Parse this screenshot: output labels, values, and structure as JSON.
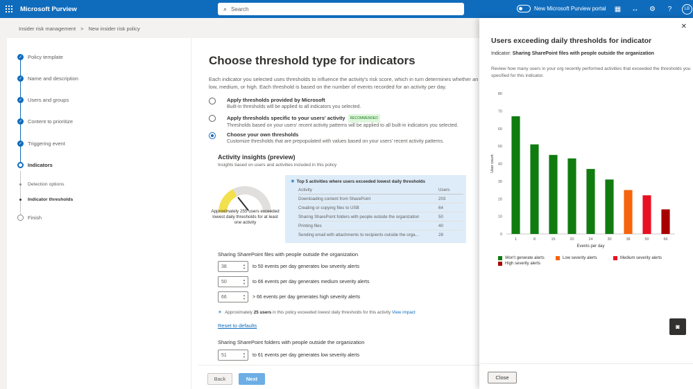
{
  "topbar": {
    "app_title": "Microsoft Purview",
    "search_placeholder": "Search",
    "portal_toggle_label": "New Microsoft Purview portal",
    "avatar_initials": "LB",
    "icons": [
      "waffle-icon",
      "search-icon",
      "chart-icon",
      "share-icon",
      "gear-icon",
      "help-icon"
    ]
  },
  "breadcrumb": {
    "items": [
      "Insider risk management",
      "New insider risk policy"
    ],
    "separator": ">"
  },
  "steps": [
    {
      "label": "Policy template",
      "state": "done"
    },
    {
      "label": "Name and description",
      "state": "done"
    },
    {
      "label": "Users and groups",
      "state": "done"
    },
    {
      "label": "Content to prioritize",
      "state": "done"
    },
    {
      "label": "Triggering event",
      "state": "done"
    },
    {
      "label": "Indicators",
      "state": "current"
    },
    {
      "label": "Detection options",
      "state": "sub"
    },
    {
      "label": "Indicator thresholds",
      "state": "sub-current"
    },
    {
      "label": "Finish",
      "state": "todo"
    }
  ],
  "main": {
    "title": "Choose threshold type for indicators",
    "description": "Each indicator you selected uses thresholds to influence the activity's risk score, which in turn determines whether an alert is low, medium, or high. Each threshold is based on the number of events recorded for an activity per day.",
    "options": [
      {
        "title": "Apply thresholds provided by Microsoft",
        "desc": "Built-in thresholds will be applied to all indicators you selected.",
        "selected": false,
        "badge": ""
      },
      {
        "title": "Apply thresholds specific to your users' activity",
        "desc": "Thresholds based on your users' recent activity patterns will be applied to all built-in indicators you selected.",
        "selected": false,
        "badge": "RECOMMENDED"
      },
      {
        "title": "Choose your own thresholds",
        "desc": "Customize thresholds that are prepopulated with values based on your users' recent activity patterns.",
        "selected": true,
        "badge": ""
      }
    ],
    "insights_title": "Activity insights (preview)",
    "insights_subtitle": "Insights based on users and activities included in this policy",
    "gauge_text": "Approximately 255 users exceeded lowest daily thresholds for at least one activity",
    "gauge_fraction": 0.35,
    "top_activities": {
      "title": "Top 5 activities where users exceeded lowest daily thresholds",
      "col_activity": "Activity",
      "col_users": "Users",
      "rows": [
        {
          "activity": "Downloading content from SharePoint",
          "users": "203"
        },
        {
          "activity": "Creating or copying files to USB",
          "users": "64"
        },
        {
          "activity": "Sharing SharePoint folders with people outside the organization",
          "users": "50"
        },
        {
          "activity": "Printing files",
          "users": "40"
        },
        {
          "activity": "Sending email with attachments to recipients outside the orga...",
          "users": "28"
        }
      ]
    },
    "section1": {
      "title": "Sharing SharePoint files with people outside the organization",
      "thresholds": [
        {
          "value": "38",
          "text": "to 50 events per day generates low severity alerts"
        },
        {
          "value": "50",
          "text": "to 66 events per day generates medium severity alerts"
        },
        {
          "value": "66",
          "text": "> 66 events per day generates high severity alerts"
        }
      ],
      "approx_prefix": "Approximately",
      "approx_users": "25 users",
      "approx_suffix": "in this policy exceeded lowest daily thresholds for this activity",
      "approx_link": "View impact"
    },
    "reset_label": "Reset to defaults",
    "section2": {
      "title": "Sharing SharePoint folders with people outside the organization",
      "thresholds": [
        {
          "value": "51",
          "text": "to 61 events per day generates low severity alerts"
        }
      ]
    },
    "back_label": "Back",
    "next_label": "Next"
  },
  "panel": {
    "title": "Users exceeding daily thresholds for indicator",
    "indicator_label": "Indicator:",
    "indicator_value": "Sharing SharePoint files with people outside the organization",
    "description": "Review how many users in your org recently performed activities that exceeded the thresholds you specified for this indicator.",
    "close_label": "Close"
  },
  "chart_data": {
    "type": "bar",
    "categories": [
      "1",
      "8",
      "15",
      "20",
      "24",
      "30",
      "38",
      "50",
      "66"
    ],
    "values": [
      67,
      51,
      45,
      43,
      37,
      31,
      25,
      22,
      14
    ],
    "colors": [
      "#107c10",
      "#107c10",
      "#107c10",
      "#107c10",
      "#107c10",
      "#107c10",
      "#f7630c",
      "#e81123",
      "#a80000"
    ],
    "xlabel": "Events per day",
    "ylabel": "User count",
    "ylim": [
      0,
      80
    ],
    "yticks": [
      "0",
      "10",
      "20",
      "30",
      "40",
      "50",
      "60",
      "70",
      "80"
    ],
    "grid": false,
    "legend": [
      {
        "label": "Won't generate alerts",
        "color": "#107c10"
      },
      {
        "label": "Low severity alerts",
        "color": "#f7630c"
      },
      {
        "label": "Medium severity alerts",
        "color": "#e81123"
      },
      {
        "label": "High severity alerts",
        "color": "#a80000"
      }
    ],
    "legend_position": "bottom"
  }
}
